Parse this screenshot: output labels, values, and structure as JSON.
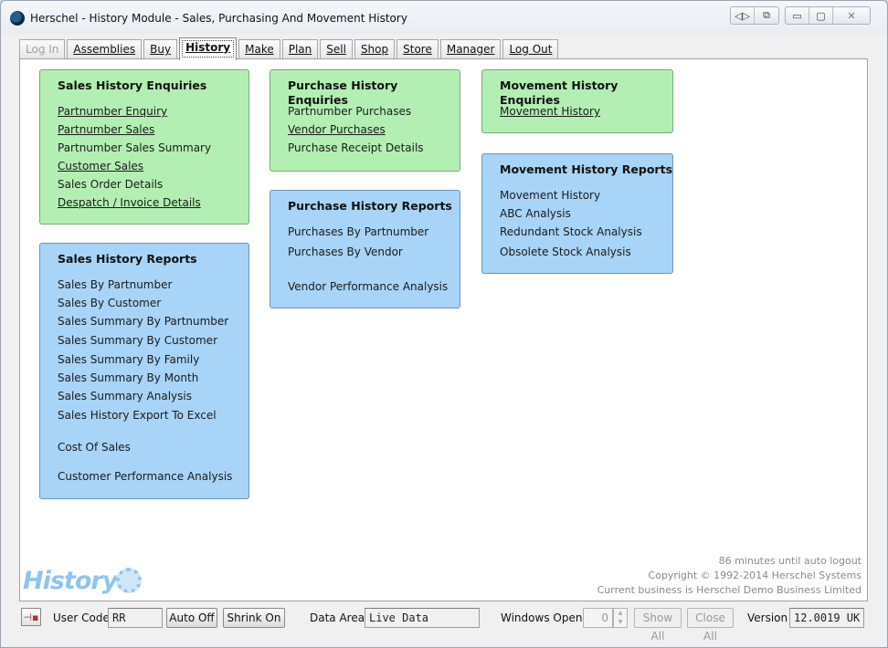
{
  "window": {
    "title": "Herschel - History Module - Sales, Purchasing And Movement History",
    "controls": {
      "left": [
        "◁▷",
        "⧉"
      ],
      "right": [
        "▭",
        "▢",
        "✕"
      ]
    }
  },
  "tabs": [
    {
      "label": "Log In",
      "state": "disabled"
    },
    {
      "label": "Assemblies",
      "state": "normal"
    },
    {
      "label": "Buy",
      "state": "normal"
    },
    {
      "label": "History",
      "state": "active"
    },
    {
      "label": "Make",
      "state": "normal"
    },
    {
      "label": "Plan",
      "state": "normal"
    },
    {
      "label": "Sell",
      "state": "normal"
    },
    {
      "label": "Shop",
      "state": "normal"
    },
    {
      "label": "Store",
      "state": "normal"
    },
    {
      "label": "Manager",
      "state": "normal"
    },
    {
      "label": "Log Out",
      "state": "normal"
    }
  ],
  "panels": {
    "sales_enquiries": {
      "title": "Sales History Enquiries",
      "items": [
        "Partnumber Enquiry",
        "Partnumber Sales",
        "Partnumber Sales Summary",
        "Customer Sales",
        "Sales Order Details",
        "Despatch / Invoice Details"
      ]
    },
    "sales_reports": {
      "title": "Sales History Reports",
      "items": [
        "Sales By Partnumber",
        "Sales By Customer",
        "Sales Summary By Partnumber",
        "Sales Summary By Customer",
        "Sales Summary By Family",
        "Sales Summary By Month",
        "Sales Summary Analysis",
        "Sales History Export To Excel",
        "Cost Of Sales",
        "Customer Performance Analysis"
      ]
    },
    "purchase_enquiries": {
      "title": "Purchase History Enquiries",
      "items": [
        "Partnumber Purchases",
        "Vendor Purchases",
        "Purchase Receipt Details"
      ]
    },
    "purchase_reports": {
      "title": "Purchase History Reports",
      "items": [
        "Purchases By Partnumber",
        "Purchases By Vendor",
        "Vendor Performance Analysis"
      ]
    },
    "movement_enquiries": {
      "title": "Movement History Enquiries",
      "items": [
        "Movement History"
      ]
    },
    "movement_reports": {
      "title": "Movement History Reports",
      "items": [
        "Movement History",
        "ABC Analysis",
        "Redundant Stock Analysis",
        "Obsolete Stock Analysis"
      ]
    }
  },
  "info": {
    "timeout": "86 minutes until auto logout",
    "copyright": "Copyright © 1992-2014 Herschel Systems",
    "business": "Current business is Herschel Demo Business Limited"
  },
  "logo": {
    "text": "History"
  },
  "status": {
    "pin_icon": "pin-icon",
    "user_code_label": "User Code",
    "user_code": "RR",
    "auto_off": "Auto Off",
    "shrink_on": "Shrink On",
    "data_area_label": "Data Area",
    "data_area": "Live Data",
    "windows_open_label": "Windows Open",
    "windows_open": "0",
    "show_all": "Show All",
    "close_all": "Close All",
    "version_label": "Version",
    "version": "12.0019 UK"
  },
  "colors": {
    "enquiry_green": "#b3efb3",
    "report_blue": "#a8d4f7",
    "logo_blue": "#8fc4ef"
  }
}
